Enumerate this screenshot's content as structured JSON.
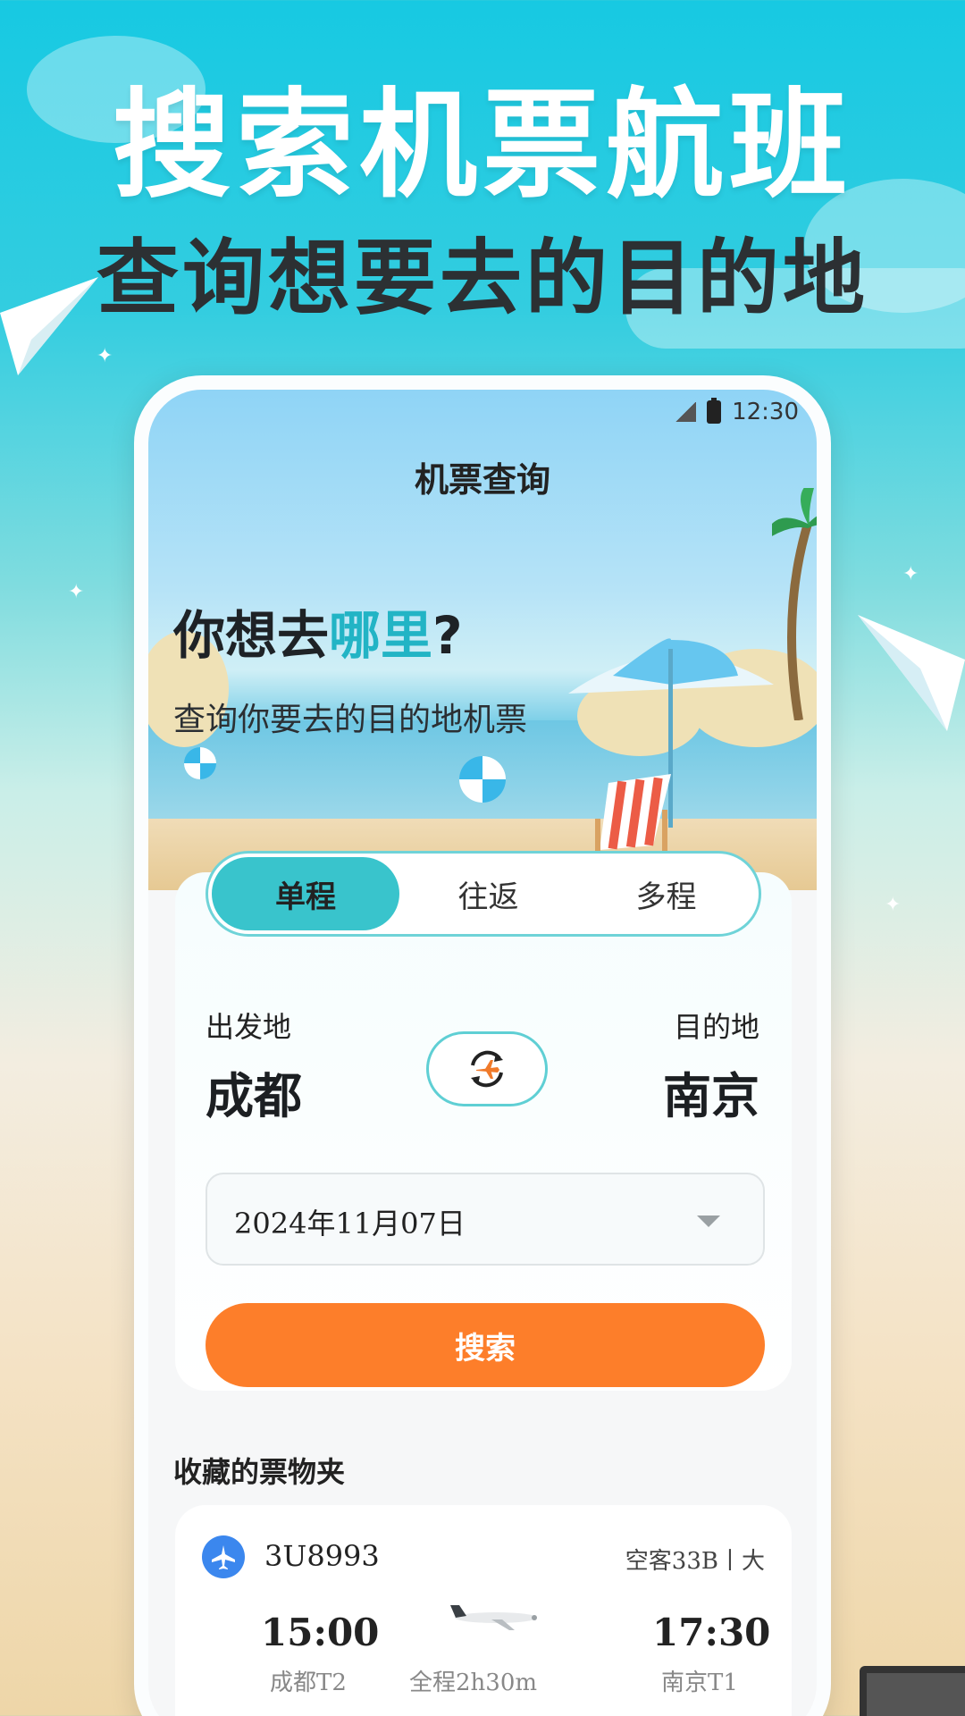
{
  "promo": {
    "headline": "搜索机票航班",
    "subheadline": "查询想要去的目的地"
  },
  "status_bar": {
    "time": "12:30"
  },
  "page_title": "机票查询",
  "hero": {
    "question_prefix": "你想去",
    "question_highlight": "哪里",
    "question_suffix": "?",
    "subtitle": "查询你要去的目的地机票"
  },
  "trip_tabs": [
    {
      "label": "单程",
      "active": true
    },
    {
      "label": "往返",
      "active": false
    },
    {
      "label": "多程",
      "active": false
    }
  ],
  "route": {
    "from_label": "出发地",
    "from_city": "成都",
    "to_label": "目的地",
    "to_city": "南京"
  },
  "date": {
    "value": "2024年11月07日"
  },
  "search_button": "搜索",
  "favorites": {
    "section_title": "收藏的票物夹",
    "flight": {
      "number": "3U8993",
      "aircraft": "空客33B丨大",
      "depart_time": "15:00",
      "depart_airport": "成都T2",
      "duration": "全程2h30m",
      "arrive_time": "17:30",
      "arrive_airport": "南京T1"
    }
  },
  "colors": {
    "accent_teal": "#39c4cc",
    "search_orange": "#fd7e2a",
    "airline_blue": "#3b87ee"
  }
}
